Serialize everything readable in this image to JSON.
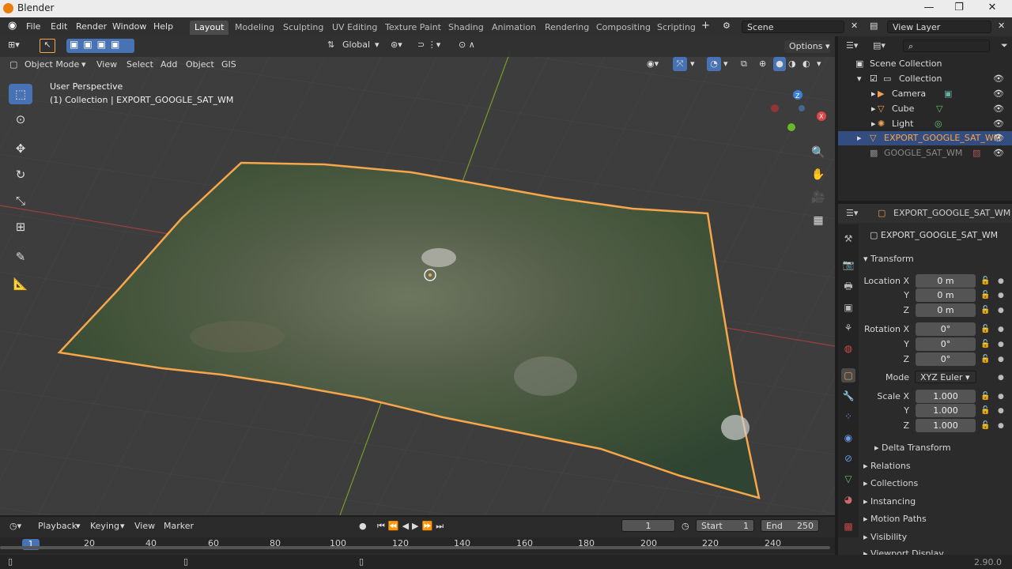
{
  "titlebar": {
    "title": "Blender",
    "minimize": "—",
    "maximize": "❐",
    "close": "✕"
  },
  "menu": [
    "File",
    "Edit",
    "Render",
    "Window",
    "Help"
  ],
  "workspaces": [
    "Layout",
    "Modeling",
    "Sculpting",
    "UV Editing",
    "Texture Paint",
    "Shading",
    "Animation",
    "Rendering",
    "Compositing",
    "Scripting"
  ],
  "active_workspace": "Layout",
  "scene": "Scene",
  "view_layer": "View Layer",
  "viewport": {
    "transform_orientation": "Global",
    "options_label": "Options",
    "mode": "Object Mode",
    "header_menu": [
      "View",
      "Select",
      "Add",
      "Object",
      "GIS"
    ],
    "overlay_line1": "User Perspective",
    "overlay_line2": "(1) Collection | EXPORT_GOOGLE_SAT_WM",
    "gizmo": {
      "z": "Z",
      "y": "Y",
      "x": "X"
    }
  },
  "outliner": {
    "root": "Scene Collection",
    "items": [
      {
        "label": "Collection"
      },
      {
        "label": "Camera"
      },
      {
        "label": "Cube"
      },
      {
        "label": "Light"
      },
      {
        "label": "EXPORT_GOOGLE_SAT_WM"
      },
      {
        "label": "GOOGLE_SAT_WM"
      }
    ]
  },
  "properties": {
    "header_object": "EXPORT_GOOGLE_SAT_WM",
    "object_name": "EXPORT_GOOGLE_SAT_WM",
    "transform_title": "Transform",
    "location": {
      "label": "Location X",
      "x": "0 m",
      "y": "0 m",
      "z": "0 m"
    },
    "rotation": {
      "label": "Rotation X",
      "x": "0°",
      "y": "0°",
      "z": "0°"
    },
    "mode": {
      "label": "Mode",
      "value": "XYZ Euler"
    },
    "scale": {
      "label": "Scale X",
      "x": "1.000",
      "y": "1.000",
      "z": "1.000"
    },
    "axis_y": "Y",
    "axis_z": "Z",
    "delta": "Delta Transform",
    "panels": [
      "Relations",
      "Collections",
      "Instancing",
      "Motion Paths",
      "Visibility",
      "Viewport Display"
    ]
  },
  "timeline": {
    "menu": [
      "Playback",
      "Keying",
      "View",
      "Marker"
    ],
    "current_frame": "1",
    "start_label": "Start",
    "start": "1",
    "end_label": "End",
    "end": "250",
    "ticks": [
      "20",
      "40",
      "60",
      "80",
      "100",
      "120",
      "140",
      "160",
      "180",
      "200",
      "220",
      "240"
    ],
    "frame_marker": "1"
  },
  "status": {
    "version": "2.90.0"
  },
  "colors": {
    "selection": "#f7a64a",
    "accent": "#4772b3",
    "terrain": "#4a5a3e"
  }
}
